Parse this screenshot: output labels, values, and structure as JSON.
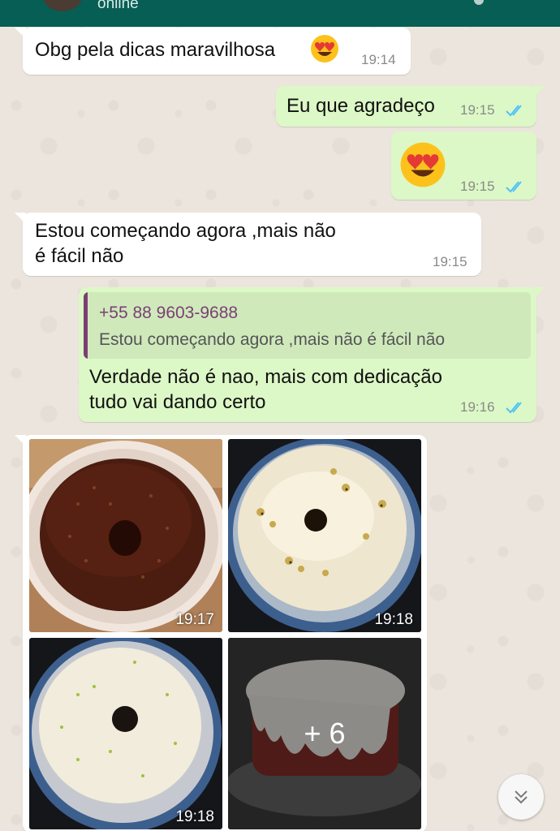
{
  "header": {
    "status": "online"
  },
  "messages": [
    {
      "text": "Obg pela dicas maravilhosa",
      "time": "19:14"
    },
    {
      "text": "Eu que agradeço",
      "time": "19:15"
    },
    {
      "time": "19:15",
      "emoji": "smiling-face-with-heart-eyes"
    },
    {
      "line1": "Estou começando agora ,mais não",
      "line2": "é fácil não",
      "time": "19:15"
    },
    {
      "quote_author": "+55 88 9603-9688",
      "quote_text": "Estou começando agora ,mais não é fácil não",
      "line1": "Verdade não é nao, mais com dedicação",
      "line2": "tudo vai dando certo",
      "time": "19:16"
    }
  ],
  "album": {
    "photos": [
      {
        "time": "19:17",
        "desc": "chocolate-bundt-cake-icon"
      },
      {
        "time": "19:18",
        "desc": "passionfruit-bundt-cake-icon"
      },
      {
        "time": "19:18",
        "desc": "lime-bundt-cake-icon"
      },
      {
        "more": "+ 6",
        "desc": "frosted-cake-icon"
      }
    ]
  },
  "colors": {
    "incoming": "#ffffff",
    "outgoing": "#dcf8c6",
    "read_ticks": "#4fc3f7",
    "header": "#075e54"
  },
  "scroll_button": {
    "icon": "double-chevron-down-icon"
  }
}
